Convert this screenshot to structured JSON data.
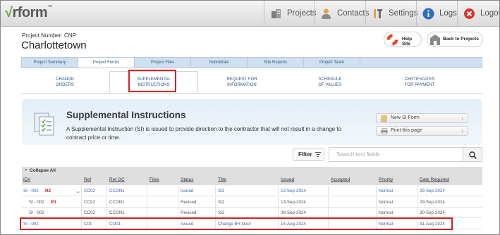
{
  "app": {
    "logo_text": "rform",
    "nav": [
      {
        "label": "Projects",
        "icon": "building-icon"
      },
      {
        "label": "Contacts",
        "icon": "person-icon"
      },
      {
        "label": "Settings",
        "icon": "tools-icon"
      },
      {
        "label": "Logs",
        "icon": "info-icon"
      },
      {
        "label": "Logout",
        "icon": "logout-icon"
      }
    ]
  },
  "project": {
    "number_label": "Project Number: CNP",
    "name": "Charlottetown",
    "help_label": "Help Site",
    "back_label": "Back to Projects"
  },
  "tabs": [
    {
      "label": "Project Summary",
      "active": false
    },
    {
      "label": "Project Forms",
      "active": true
    },
    {
      "label": "Project Files",
      "active": false
    },
    {
      "label": "Submittals",
      "active": false
    },
    {
      "label": "Site Reports",
      "active": false
    },
    {
      "label": "Project Team",
      "active": false
    }
  ],
  "subtabs": [
    {
      "line1": "CHANGE",
      "line2": "ORDERS",
      "selected": false
    },
    {
      "line1": "SUPPLEMENTAL",
      "line2": "INSTRUCTIONS",
      "selected": true
    },
    {
      "line1": "REQUEST FOR",
      "line2": "INFORMATION",
      "selected": false
    },
    {
      "line1": "SCHEDULE",
      "line2": "OF VALUES",
      "selected": false
    },
    {
      "line1": "CERTIFICATES",
      "line2": "FOR PAYMENT",
      "selected": false
    }
  ],
  "panel": {
    "title": "Supplemental Instructions",
    "description": "A Supplemental Instruction (SI) is issued to provide direction to the contractor that will not result in a change to contract price or time.",
    "new_label": "New SI Form",
    "print_label": "Print this page"
  },
  "toolbar": {
    "filter_label": "Filter",
    "search_placeholder": "Search text fields"
  },
  "table": {
    "collapse_label": "Collapse All",
    "headers": [
      "ID#",
      "Ref",
      "Ref GC",
      "Files",
      "Status",
      "Title",
      "Issued",
      "Accepted",
      "Priority",
      "Date Required"
    ],
    "rows": [
      {
        "id": "SI - 002",
        "rev": "R2",
        "ref": "CC02",
        "refgc": "CCON1",
        "files": "",
        "status": "Issued",
        "title": "SI2",
        "issued": "13-Sep-2024",
        "accepted": "",
        "priority": "Normal",
        "date_required": "29-Sep-2024"
      },
      {
        "id": "SI - 002",
        "rev": "R1",
        "ref": "CC02",
        "refgc": "CCON1",
        "files": "",
        "status": "Revised",
        "title": "SI2",
        "issued": "13-Sep-2024",
        "accepted": "",
        "priority": "Normal",
        "date_required": "29-Sep-2024"
      },
      {
        "id": "SI - 002",
        "rev": "",
        "ref": "CC02",
        "refgc": "CCON1",
        "files": "",
        "status": "Revised",
        "title": "SI2",
        "issued": "08-Sep-2024",
        "accepted": "",
        "priority": "Normal",
        "date_required": "30-Sep-2024"
      },
      {
        "id": "SI - 001",
        "rev": "",
        "ref": "C01",
        "refgc": "CO01",
        "files": "",
        "status": "Issued",
        "title": "Change BR Door",
        "issued": "16-Aug-2024",
        "accepted": "",
        "priority": "Normal",
        "date_required": "31-Aug-2024"
      }
    ]
  },
  "colors": {
    "accent_blue": "#3865a8",
    "highlight_red": "#d42020",
    "tab_bg": "#d0e0f2"
  }
}
